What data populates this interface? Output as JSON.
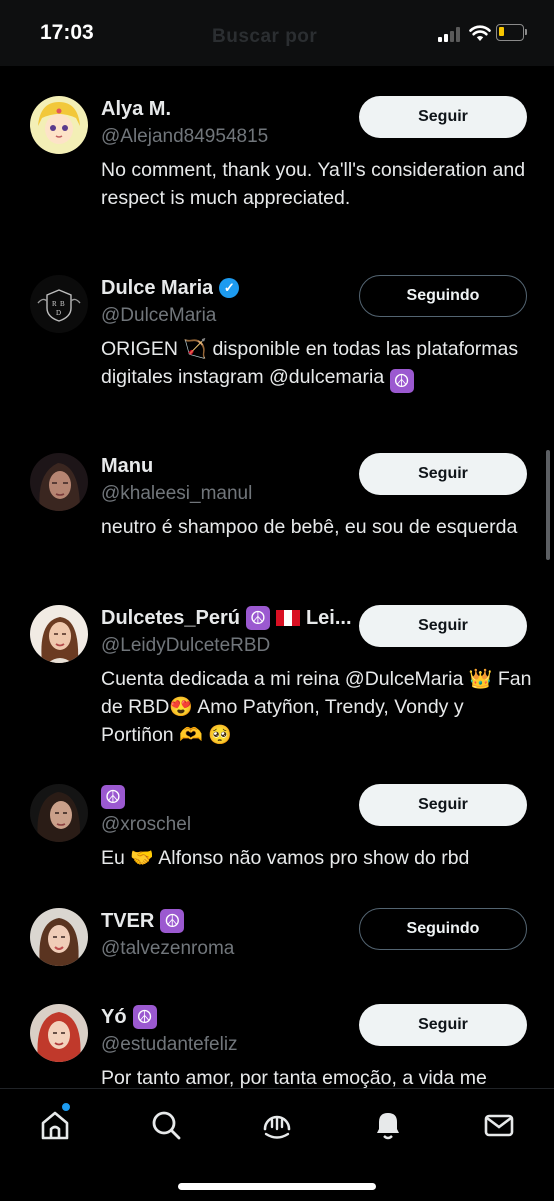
{
  "status_bar": {
    "time": "17:03",
    "ghost_title": "Buscar por"
  },
  "icons": {
    "signal": "cellular-signal-icon",
    "wifi": "wifi-icon",
    "battery": "battery-low-icon",
    "home": "home-icon",
    "search": "search-icon",
    "spaces": "spaces-icon",
    "notifications": "bell-icon",
    "messages": "envelope-icon"
  },
  "users": [
    {
      "name": "Alya M.",
      "handle": "@Alejand84954815",
      "bio": "No comment, thank you. Ya'll's consideration and respect is much appreciated.",
      "button": "Seguir"
    },
    {
      "name": "Dulce Maria",
      "handle": "@DulceMaria",
      "bio_parts": [
        "ORIGEN",
        "🏹",
        "disponible en todas las plataformas digitales instagram @dulcemaria"
      ],
      "button": "Seguindo"
    },
    {
      "name": "Manu",
      "handle": "@khaleesi_manul",
      "bio": "neutro é shampoo de bebê, eu sou de esquerda",
      "button": "Seguir"
    },
    {
      "name": "Dulcetes_Perú",
      "name_suffix": "Lei...",
      "handle": "@LeidyDulceteRBD",
      "bio_parts": [
        "Cuenta dedicada a mi reina @DulceMaria",
        "👑",
        "Fan de RBD",
        "😍",
        "Amo Patyñon, Trendy, Vondy y Portiñon",
        "🫶",
        "🥺"
      ],
      "button": "Seguir"
    },
    {
      "name": "",
      "handle": "@xroschel",
      "bio_parts": [
        "Eu",
        "🤝",
        "Alfonso não vamos pro show do rbd"
      ],
      "button": "Seguir"
    },
    {
      "name": "TVER",
      "handle": "@talvezenroma",
      "button": "Seguindo"
    },
    {
      "name": "Yó",
      "handle": "@estudantefeliz",
      "bio": "Por tanto amor, por tanta emoção, a vida me",
      "button": "Seguir"
    }
  ],
  "colors": {
    "background": "#000000",
    "text": "#e7e9ea",
    "secondary": "#71767b",
    "accent": "#1d9bf0",
    "follow_button_bg": "#eff3f4"
  }
}
